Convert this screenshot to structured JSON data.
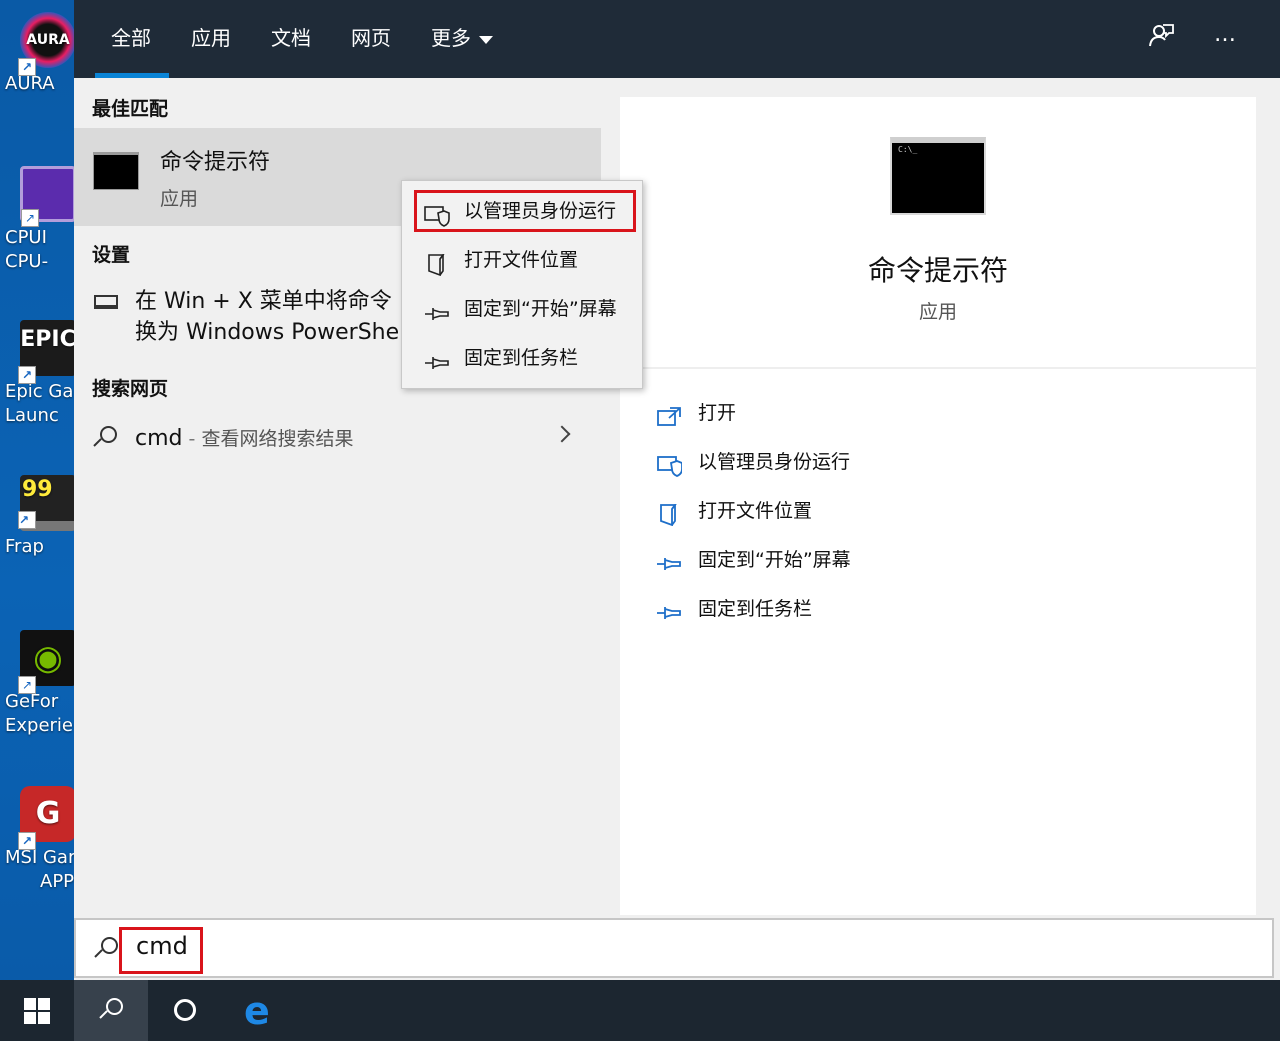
{
  "desktop": {
    "icons": [
      {
        "name": "aura",
        "img_text": "AURA",
        "line1": "AURA",
        "line2": ""
      },
      {
        "name": "cpu",
        "img_text": "",
        "line1": "CPUI",
        "line2": "CPU-"
      },
      {
        "name": "epic",
        "img_text": "EPIC",
        "line1": "Epic Ga",
        "line2": "Launc"
      },
      {
        "name": "fraps",
        "img_text": "99",
        "line1": "Frap",
        "line2": ""
      },
      {
        "name": "geforce",
        "img_text": "◉",
        "line1": "GeFor",
        "line2": "Experie"
      },
      {
        "name": "msi",
        "img_text": "G",
        "line1": "MSI Gar",
        "line2": "APP"
      }
    ]
  },
  "search_panel": {
    "tabs": [
      {
        "label": "全部",
        "active": true
      },
      {
        "label": "应用",
        "active": false
      },
      {
        "label": "文档",
        "active": false
      },
      {
        "label": "网页",
        "active": false
      },
      {
        "label": "更多",
        "active": false
      }
    ],
    "feedback_icon": "feedback-icon",
    "more_icon": "…",
    "best_match": {
      "heading": "最佳匹配",
      "title": "命令提示符",
      "subtitle": "应用"
    },
    "settings": {
      "heading": "设置",
      "text_line1": "在 Win + X 菜单中将命令",
      "text_line2": "换为 Windows PowerShe"
    },
    "web": {
      "heading": "搜索网页",
      "query": "cmd",
      "separator": " - ",
      "suffix": "查看网络搜索结果"
    },
    "context_menu": [
      {
        "label": "以管理员身份运行",
        "icon": "shield-icon",
        "highlighted": true
      },
      {
        "label": "打开文件位置",
        "icon": "folder-icon",
        "highlighted": false
      },
      {
        "label": "固定到“开始”屏幕",
        "icon": "pin-icon",
        "highlighted": false
      },
      {
        "label": "固定到任务栏",
        "icon": "pin-icon",
        "highlighted": false
      }
    ],
    "preview": {
      "thumb_text": "C:\\_",
      "title": "命令提示符",
      "subtitle": "应用",
      "actions": [
        {
          "label": "打开",
          "icon": "open-icon"
        },
        {
          "label": "以管理员身份运行",
          "icon": "shield-icon"
        },
        {
          "label": "打开文件位置",
          "icon": "folder-icon"
        },
        {
          "label": "固定到“开始”屏幕",
          "icon": "pin-icon"
        },
        {
          "label": "固定到任务栏",
          "icon": "pin-icon"
        }
      ]
    },
    "search_box": {
      "value": "cmd",
      "highlighted": true
    }
  },
  "taskbar": {
    "items": [
      "windows-start",
      "search",
      "cortana",
      "edge"
    ],
    "edge_glyph": "e"
  },
  "colors": {
    "accent": "#0a84d6",
    "highlight_box": "#d9141b",
    "topbar": "#1f2b38",
    "taskbar": "#1c2630",
    "action_icon": "#1e6fc9"
  }
}
